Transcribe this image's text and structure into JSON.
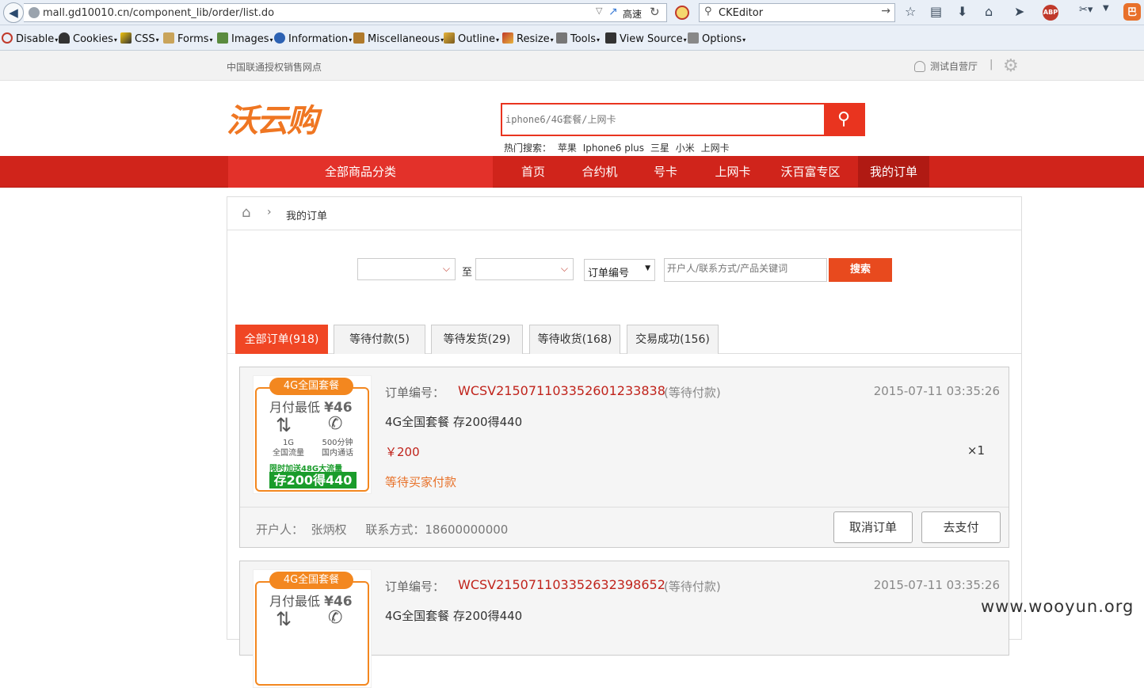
{
  "browser": {
    "url": "mall.gd10010.cn/component_lib/order/list.do",
    "fast_label": "高速",
    "search_value": "CKEditor"
  },
  "webdev": {
    "items": [
      "Disable",
      "Cookies",
      "CSS",
      "Forms",
      "Images",
      "Information",
      "Miscellaneous",
      "Outline",
      "Resize",
      "Tools",
      "View Source",
      "Options"
    ]
  },
  "site": {
    "topbar_text": "中国联通授权销售网点",
    "user_link": "测试自营厅",
    "separator": "|",
    "logo": "沃云购",
    "search_placeholder": "iphone6/4G套餐/上网卡",
    "hot_label": "热门搜索：",
    "hot_items": [
      "苹果",
      "Iphone6 plus",
      "三星",
      "小米",
      "上网卡"
    ],
    "all_categories": "全部商品分类",
    "nav": [
      "首页",
      "合约机",
      "号卡",
      "上网卡",
      "沃百富专区",
      "我的订单"
    ]
  },
  "breadcrumb": {
    "current": "我的订单"
  },
  "filter": {
    "to_label": "至",
    "type_value": "订单编号",
    "keyword_placeholder": "开户人/联系方式/产品关键词",
    "search_button": "搜索"
  },
  "tabs": [
    "全部订单(918)",
    "等待付款(5)",
    "等待发货(29)",
    "等待收货(168)",
    "交易成功(156)"
  ],
  "product_image": {
    "banner": "4G全国套餐",
    "price_prefix": "月付最低",
    "price": "¥46",
    "data_label": "1G\n全国流量",
    "call_label": "500分钟\n国内通话",
    "promo": "限时加送48G大流量",
    "save": "存200得440"
  },
  "orders": [
    {
      "order_label": "订单编号：",
      "order_no": "WCSV215071103352601233838",
      "status": "(等待付款)",
      "time": "2015-07-11 03:35:26",
      "product": "4G全国套餐 存200得440",
      "price": "￥200",
      "qty": "×1",
      "wait_text": "等待买家付款",
      "holder": "开户人：  张炳权     联系方式：18600000000",
      "cancel": "取消订单",
      "pay": "去支付"
    },
    {
      "order_label": "订单编号：",
      "order_no": "WCSV215071103352632398652",
      "status": "(等待付款)",
      "time": "2015-07-11 03:35:26",
      "product": "4G全国套餐 存200得440"
    }
  ],
  "watermark": "www.wooyun.org"
}
